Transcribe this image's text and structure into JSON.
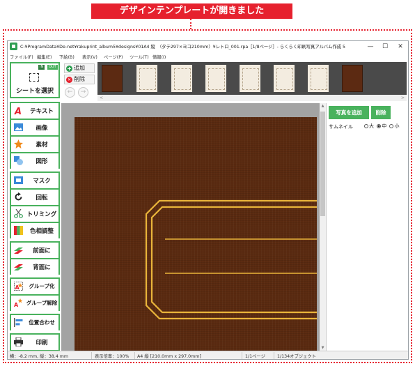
{
  "banner": {
    "text": "デザインテンプレートが開きました",
    "color": "#e6212e"
  },
  "window": {
    "title": "C:¥ProgramData¥De-net¥rakuprint_album5¥designs¥01A4 縦　（タテ297×ヨコ210ｍｍ）¥レトロ_001.rpa［1/8ページ］- らくらく印刷写真アルバム作成 5",
    "controls": {
      "minimize": "—",
      "maximize": "☐",
      "close": "✕"
    }
  },
  "menu": [
    "ファイル(F)",
    "編集(E)",
    "下絵(B)",
    "表示(V)",
    "ページ(P)",
    "ツール(T)",
    "情報(I)"
  ],
  "left_toolbar": {
    "in_label": "IN",
    "out_label": "OUT",
    "select": {
      "label": "シートを選択",
      "icon": "select-cursor-icon"
    },
    "groups": [
      [
        {
          "label": "テキスト",
          "icon": "text-a-icon"
        },
        {
          "label": "画像",
          "icon": "image-icon"
        },
        {
          "label": "素材",
          "icon": "star-icon"
        },
        {
          "label": "図形",
          "icon": "shape-icon"
        }
      ],
      [
        {
          "label": "マスク",
          "icon": "mask-icon"
        },
        {
          "label": "回転",
          "icon": "rotate-icon"
        },
        {
          "label": "トリミング",
          "icon": "scissors-icon"
        },
        {
          "label": "色相調整",
          "icon": "hue-icon"
        }
      ],
      [
        {
          "label": "前面に",
          "icon": "bring-front-icon"
        },
        {
          "label": "背面に",
          "icon": "send-back-icon"
        }
      ],
      [
        {
          "label": "グループ化",
          "icon": "group-icon"
        },
        {
          "label": "グループ解除",
          "icon": "ungroup-icon"
        }
      ],
      [
        {
          "label": "位置合わせ",
          "icon": "align-icon"
        }
      ],
      [
        {
          "label": "印刷",
          "icon": "printer-icon"
        }
      ]
    ]
  },
  "image_bar": {
    "add_label": "追加",
    "delete_label": "削除",
    "prev": "←",
    "next": "→",
    "scroll_left": "<",
    "scroll_right": ">",
    "thumbnails": [
      "brown",
      "cream",
      "cream",
      "cream",
      "cream",
      "cream",
      "cream",
      "brown"
    ]
  },
  "right_panel": {
    "add_photo": "写真を追加",
    "delete": "削除",
    "thumbnail_label": "サムネイル",
    "sizes": [
      "大",
      "中",
      "小"
    ],
    "selected_size": "中"
  },
  "status": {
    "coords": "横：-8.2 mm, 縦：38.4 mm",
    "zoom": "表示倍率：100%",
    "paper": "A4 縦 [210.0mm x 297.0mm]",
    "page": "1/1ページ",
    "objects": "1/134オブジェクト"
  },
  "colors": {
    "accent_green": "#49b25d",
    "page_brown": "#5a2a10",
    "gold_frame": "#e9b43a"
  }
}
